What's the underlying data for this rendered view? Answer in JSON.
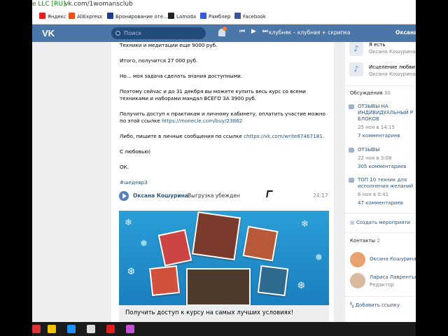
{
  "browser": {
    "secure_label": "e LLC [RU]",
    "url": "vk.com/1womansclub",
    "bookmarks": [
      {
        "label": "Яндекс",
        "icon": "yandex-icon",
        "color": "#e02020"
      },
      {
        "label": "AliExpress",
        "icon": "aliexpress-icon",
        "color": "#e8501c"
      },
      {
        "label": "Бронирование оте...",
        "icon": "booking-icon",
        "color": "#1e3c8c"
      },
      {
        "label": "Lamoda",
        "icon": "lamoda-icon",
        "color": "#222222"
      },
      {
        "label": "Рамблер",
        "icon": "rambler-icon",
        "color": "#3a5ad8"
      },
      {
        "label": "Facebook",
        "icon": "facebook-icon",
        "color": "#3b5998"
      }
    ]
  },
  "vk": {
    "logo": "VK",
    "search_placeholder": "Поиск",
    "player": {
      "prev": "⏮",
      "play": "▶",
      "next": "⏭"
    },
    "track": "клубняк – клубная + скрипка",
    "user_name": "Оксана",
    "brand_color": "#4a76a8"
  },
  "post": {
    "paragraphs": [
      "Техники и медитации еще 9000 руб.",
      "Итого, получится 27 000 руб.",
      "Но... моя задача сделать знания доступными.",
      "Поэтому сейчас и до 31 декбря вы можете купить весь курс со всеми техниками и наборами мандал ВСЕГО ЗА 3900 руб.",
      "Получить доступ к практикам и личному кабинету, оплатить участие можно по этой ссылке",
      "Либо, пишите в личные сообщения по ссылке ",
      "С любовью)",
      "ОК."
    ],
    "pay_link": "https://monecle.com/buy/23862",
    "message_link": "chttps://vk.com/write87467181.",
    "hashtag": "#шедевр3",
    "audio": {
      "artist": "Оксана Кошурина",
      "dash": "–",
      "title": "Выгрузка убежден",
      "duration": "24:17"
    },
    "promo_caption": "Получить доступ к курсу на самых лучших условиях!"
  },
  "sidebar": {
    "tracks": [
      {
        "title": "Я есть",
        "artist": "Оксана Кошурина"
      },
      {
        "title": "Исцеление любви",
        "artist": "Оксана Кошурина"
      }
    ],
    "discussions_label": "Обсуждения",
    "discussions_count": "30",
    "discussions": [
      {
        "title_lines": [
          "ОТЗЫВЫ НА",
          "ИНДИВИДУАЛЬНЫЙ Р",
          "БЛОКОВ"
        ],
        "date": "25 ноя в 14:15",
        "comments": "7 комментариев"
      },
      {
        "title_lines": [
          "ОТЗЫВЫ"
        ],
        "date": "22 ноя в 3:08",
        "comments": "305 комментариев"
      },
      {
        "title_lines": [
          "ТОП 10 техник для",
          "исполнения желаний"
        ],
        "date": "6 ноя в 0:41",
        "comments": "47 комментариев"
      }
    ],
    "create_event": "Создать мероприяти",
    "contacts_label": "Контакты",
    "contacts_count": "2",
    "contacts": [
      {
        "name": "Оксана Кошурина",
        "role": ""
      },
      {
        "name": "Лариса Лаврентьев",
        "role": "Редактор"
      }
    ],
    "add_link": "Добавить ссылку"
  }
}
